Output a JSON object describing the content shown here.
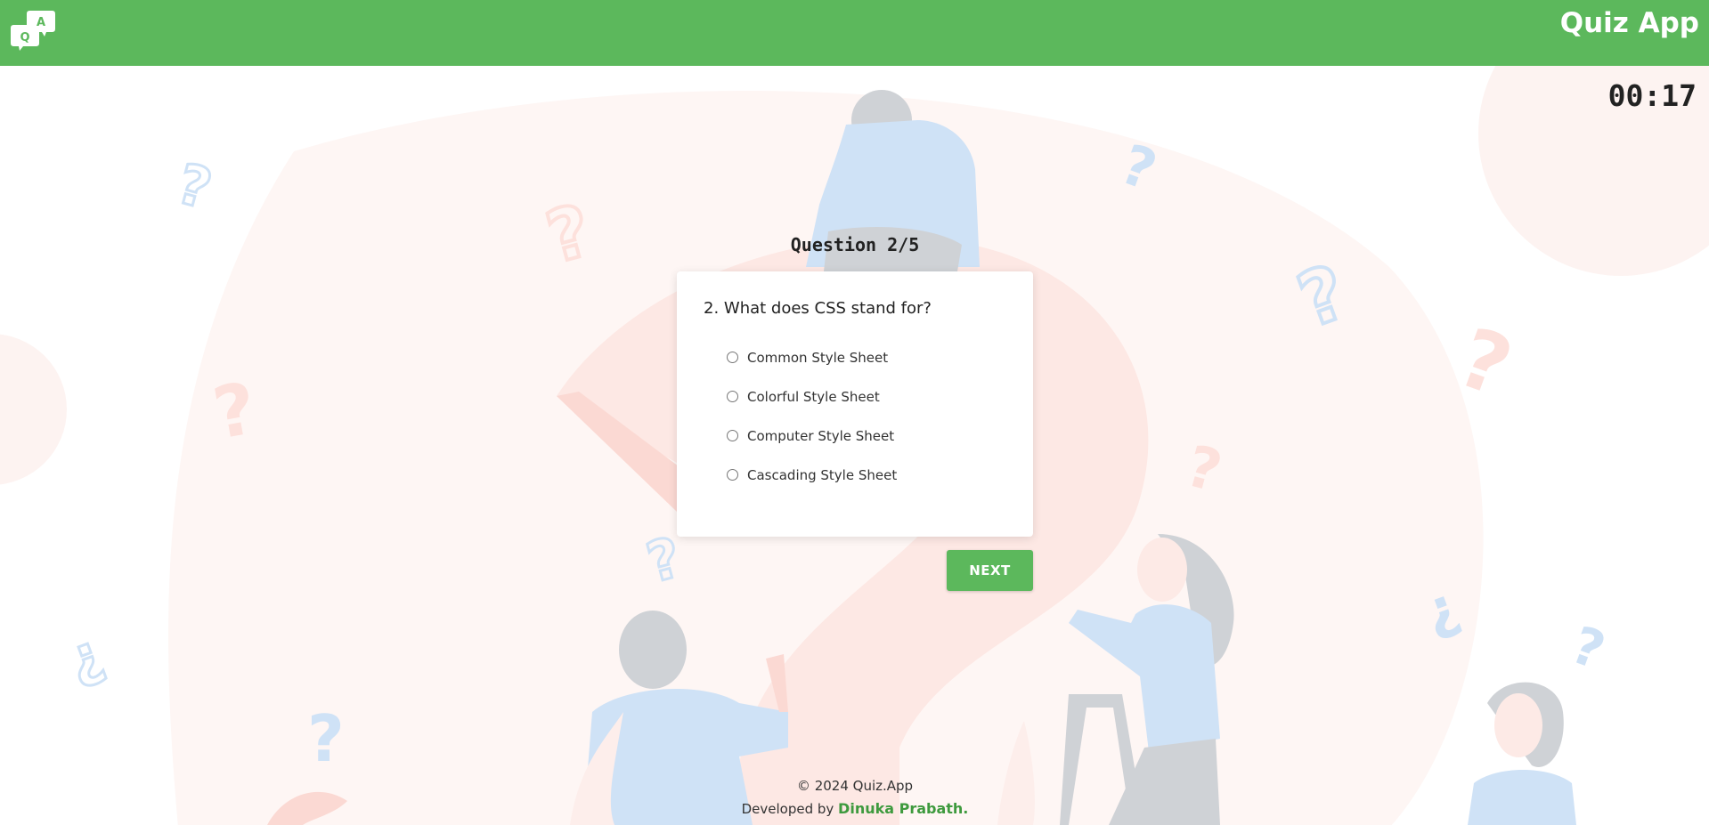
{
  "header": {
    "logo_letters": [
      "Q",
      "A"
    ],
    "app_title": "Quiz App",
    "color": "#5cb85c"
  },
  "timer": {
    "value": "00:17"
  },
  "quiz": {
    "counter": "Question 2/5",
    "question": "2. What does CSS stand for?",
    "options": [
      "Common Style Sheet",
      "Colorful Style Sheet",
      "Computer Style Sheet",
      "Cascading Style Sheet"
    ],
    "selected": null,
    "next_label": "NEXT"
  },
  "footer": {
    "copyright": "© 2024 Quiz.App",
    "developed_by": "Developed by",
    "developer": "Dinuka Prabath."
  },
  "colors": {
    "accent": "#5cb85c",
    "developer_link": "#3e9a3e",
    "illustration_blue": "#cfe2f6",
    "illustration_pink": "#fde1dc",
    "illustration_gray": "#cfd2d6"
  }
}
